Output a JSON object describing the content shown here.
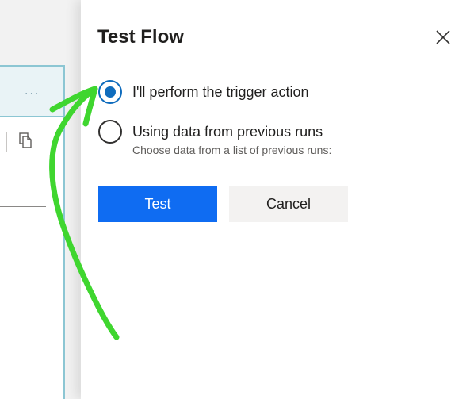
{
  "background": {
    "more_label": "...",
    "copy_icon": "copy-icon"
  },
  "panel": {
    "title": "Test Flow",
    "close_icon": "close-icon",
    "options": [
      {
        "label": "I'll perform the trigger action",
        "selected": true
      },
      {
        "label": "Using data from previous runs",
        "sublabel": "Choose data from a list of previous runs:",
        "selected": false
      }
    ],
    "test_label": "Test",
    "cancel_label": "Cancel"
  },
  "colors": {
    "accent": "#0f6cbd",
    "primary_button": "#0f6cf2",
    "annotation": "#3fd62f"
  }
}
